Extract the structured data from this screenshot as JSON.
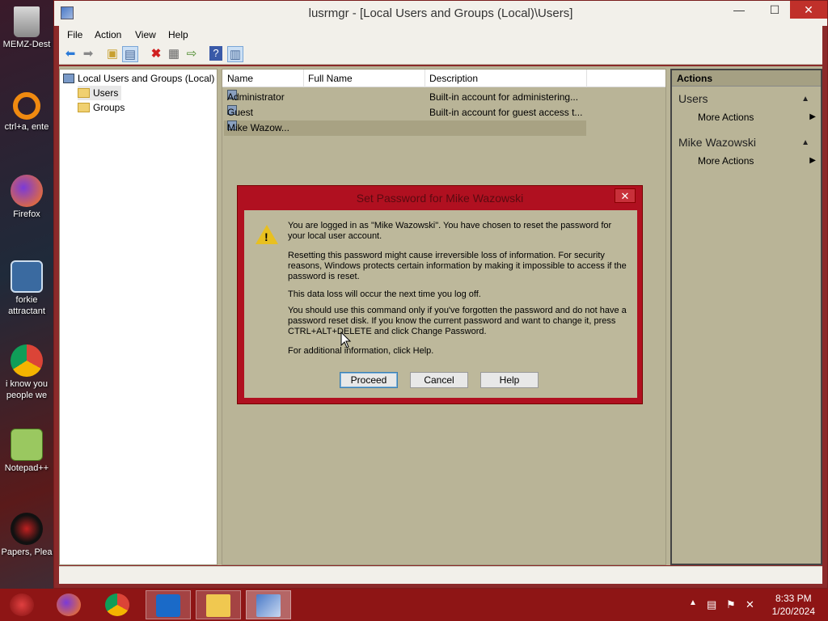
{
  "desktop": {
    "icons": [
      {
        "label": "MEMZ-Dest",
        "icon": "recycle-bin-icon"
      },
      {
        "label": "ctrl+a, ente",
        "icon": "orange-ring-icon"
      },
      {
        "label": "Firefox",
        "icon": "firefox-icon"
      },
      {
        "label": "forkie",
        "label2": "attractant",
        "icon": "settings-pc-icon"
      },
      {
        "label": "i know you",
        "label2": "people we",
        "icon": "chrome-icon"
      },
      {
        "label": "Notepad++",
        "icon": "notepad-plus-plus-icon"
      },
      {
        "label": "Papers, Plea",
        "icon": "papers-please-icon"
      }
    ]
  },
  "window": {
    "title": "lusrmgr - [Local Users and Groups (Local)\\Users]",
    "controls": {
      "minimize": "—",
      "maximize": "☐",
      "close": "✕"
    }
  },
  "menubar": [
    "File",
    "Action",
    "View",
    "Help"
  ],
  "toolbar": {
    "buttons": [
      "back-arrow-icon",
      "forward-arrow-icon",
      "up-folder-icon",
      "show-tree-icon",
      "delete-icon",
      "properties-icon",
      "export-icon",
      "help-icon",
      "console-view-icon"
    ]
  },
  "tree": {
    "root": "Local Users and Groups (Local)",
    "children": [
      "Users",
      "Groups"
    ]
  },
  "list": {
    "columns": [
      "Name",
      "Full Name",
      "Description"
    ],
    "rows": [
      {
        "name": "Administrator",
        "full_name": "",
        "description": "Built-in account for administering..."
      },
      {
        "name": "Guest",
        "full_name": "",
        "description": "Built-in account for guest access t..."
      },
      {
        "name": "Mike Wazow...",
        "full_name": "",
        "description": ""
      }
    ]
  },
  "actions": {
    "header": "Actions",
    "sections": [
      {
        "title": "Users",
        "item": "More Actions"
      },
      {
        "title": "Mike Wazowski",
        "item": "More Actions"
      }
    ]
  },
  "dialog": {
    "title": "Set Password for Mike Wazowski",
    "paragraphs": [
      "You are logged in as \"Mike Wazowski\". You have chosen to reset the password for your local user account.",
      "Resetting this password might cause irreversible loss of information. For security reasons, Windows protects certain information by making it impossible to access if the password is reset.",
      "This data loss will occur the next time you log off.",
      "You should use this command only if you've forgotten the password and do not have a password reset disk. If you know the current password and want to change it, press CTRL+ALT+DELETE and click Change Password.",
      "For additional information, click Help."
    ],
    "buttons": {
      "proceed": "Proceed",
      "cancel": "Cancel",
      "help": "Help"
    }
  },
  "taskbar": {
    "apps": [
      "memz-icon",
      "firefox-icon",
      "chrome-icon",
      "outlook-icon",
      "file-explorer-icon",
      "lusrmgr-icon"
    ],
    "clock": {
      "time": "8:33 PM",
      "date": "1/20/2024"
    }
  },
  "colors": {
    "window_frame": "#8b2a2a",
    "pane_bg": "#b9b497",
    "dialog_frame": "#b01020",
    "taskbar": "#8e1515"
  }
}
